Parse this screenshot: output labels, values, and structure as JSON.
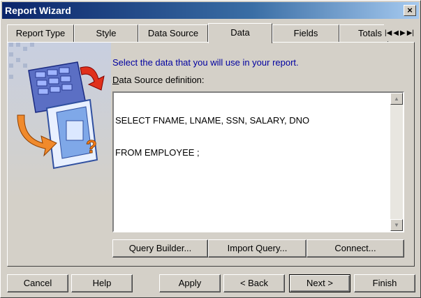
{
  "window": {
    "title": "Report Wizard",
    "close_label": "×"
  },
  "tabs": [
    {
      "label": "Report Type",
      "active": false
    },
    {
      "label": "Style",
      "active": false
    },
    {
      "label": "Data Source",
      "active": false
    },
    {
      "label": "Data",
      "active": true
    },
    {
      "label": "Fields",
      "active": false
    },
    {
      "label": "Totals",
      "active": false
    }
  ],
  "tab_scroll": {
    "first": "|◀",
    "prev": "◀",
    "next": "▶",
    "last": "▶|"
  },
  "content": {
    "instruction": "Select the data that you will use in your report.",
    "label_mnemonic": "D",
    "label_rest": "ata Source definition:",
    "query_lines": [
      "SELECT FNAME, LNAME, SSN, SALARY, DNO",
      "FROM EMPLOYEE ;"
    ],
    "scroll_up": "▲",
    "scroll_down": "▼"
  },
  "query_buttons": {
    "query_builder": "Query Builder...",
    "import_query": "Import Query...",
    "connect": "Connect..."
  },
  "footer_buttons": {
    "cancel": "Cancel",
    "help": "Help",
    "apply": "Apply",
    "back": "< Back",
    "next": "Next >",
    "finish": "Finish"
  }
}
